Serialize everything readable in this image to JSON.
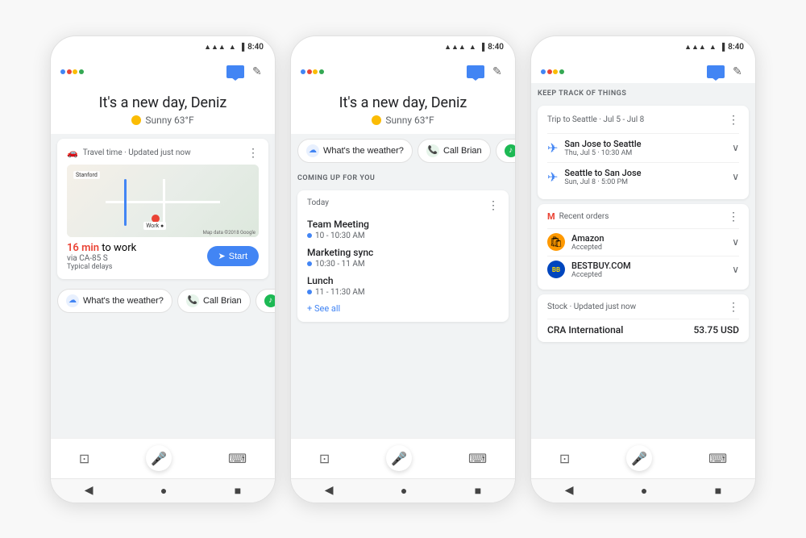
{
  "phones": [
    {
      "id": "phone1",
      "status_time": "8:40",
      "greeting": "It's a new day, Deniz",
      "weather": "Sunny 63°F",
      "travel_card": {
        "label": "Travel time · Updated just now",
        "commute_time": "16 min",
        "commute_suffix": " to work",
        "commute_via": "via CA-85 S",
        "commute_delays": "Typical delays",
        "start_label": "Start"
      },
      "quick_actions": [
        {
          "icon": "cloud",
          "label": "What's the weather?"
        },
        {
          "icon": "phone",
          "label": "Call Brian"
        },
        {
          "icon": "spotify",
          "label": "..."
        }
      ]
    },
    {
      "id": "phone2",
      "status_time": "8:40",
      "greeting": "It's a new day, Deniz",
      "weather": "Sunny 63°F",
      "quick_actions": [
        {
          "icon": "cloud",
          "label": "What's the weather?"
        },
        {
          "icon": "phone",
          "label": "Call Brian"
        },
        {
          "icon": "spotify",
          "label": "..."
        }
      ],
      "section_label": "COMING UP FOR YOU",
      "calendar": {
        "day_label": "Today",
        "events": [
          {
            "name": "Team Meeting",
            "time": "10 - 10:30 AM"
          },
          {
            "name": "Marketing sync",
            "time": "10:30 - 11 AM"
          },
          {
            "name": "Lunch",
            "time": "11 - 11:30 AM"
          }
        ],
        "see_all": "+ See all"
      }
    },
    {
      "id": "phone3",
      "status_time": "8:40",
      "section_label": "KEEP TRACK OF THINGS",
      "trip": {
        "title": "Trip to Seattle · Jul 5 - Jul 8",
        "flights": [
          {
            "route": "San Jose to Seattle",
            "date": "Thu, Jul 5 · 10:30 AM"
          },
          {
            "route": "Seattle to San Jose",
            "date": "Sun, Jul 8 · 5:00 PM"
          }
        ]
      },
      "orders": {
        "label": "Recent orders",
        "items": [
          {
            "store": "Amazon",
            "status": "Accepted"
          },
          {
            "store": "BESTBUY.COM",
            "status": "Accepted"
          }
        ]
      },
      "stock": {
        "label": "Stock · Updated just now",
        "name": "CRA International",
        "price": "53.75 USD"
      }
    }
  ],
  "icons": {
    "three_dots": "⋮",
    "back": "◀",
    "home": "●",
    "recents": "■",
    "chevron_down": "∨",
    "pencil": "✎",
    "navigation": "➤",
    "airplane": "✈",
    "tag": "🏷",
    "shop_bag": "🛍"
  }
}
